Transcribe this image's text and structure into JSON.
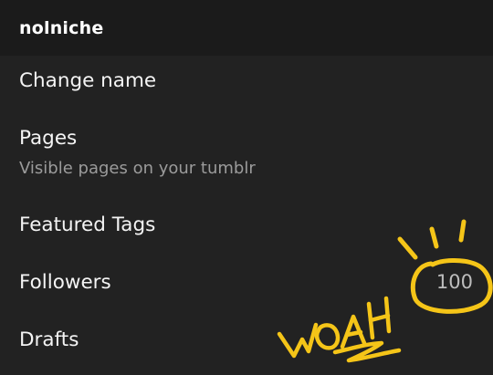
{
  "header": {
    "title": "nolniche"
  },
  "menu": {
    "items": [
      {
        "label": "Change name"
      },
      {
        "label": "Pages",
        "subtitle": "Visible pages on your tumblr"
      },
      {
        "label": "Featured Tags"
      },
      {
        "label": "Followers",
        "count": "100"
      },
      {
        "label": "Drafts"
      }
    ]
  },
  "annotation": {
    "text": "WOAH",
    "color": "#f5c518"
  },
  "colors": {
    "background": "#222222",
    "header_background": "#1b1b1b",
    "subtitle": "#9b9b9b"
  }
}
